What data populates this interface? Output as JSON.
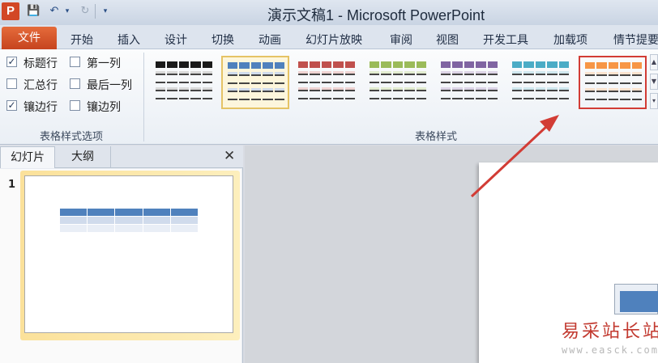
{
  "titlebar": {
    "app_icon": "P",
    "title": "演示文稿1 - Microsoft PowerPoint",
    "qat": {
      "save": "save-icon",
      "undo": "undo-icon",
      "redo": "redo-icon"
    }
  },
  "tabs": {
    "file": "文件",
    "items": [
      "开始",
      "插入",
      "设计",
      "切换",
      "动画",
      "幻灯片放映",
      "审阅",
      "视图",
      "开发工具",
      "加载项",
      "情节提要"
    ]
  },
  "ribbon": {
    "options_group": {
      "label": "表格样式选项",
      "options": [
        {
          "label": "标题行",
          "checked": true
        },
        {
          "label": "第一列",
          "checked": false
        },
        {
          "label": "汇总行",
          "checked": false
        },
        {
          "label": "最后一列",
          "checked": false
        },
        {
          "label": "镶边行",
          "checked": true
        },
        {
          "label": "镶边列",
          "checked": false
        }
      ]
    },
    "styles_group": {
      "label": "表格样式",
      "styles": [
        {
          "header": "#1a1a1a",
          "band": "#d9d9d9",
          "state": "normal"
        },
        {
          "header": "#4f81bd",
          "band": "#d0dbec",
          "state": "selected"
        },
        {
          "header": "#c0504d",
          "band": "#efd3d2",
          "state": "normal"
        },
        {
          "header": "#9bbb59",
          "band": "#e2ecd0",
          "state": "normal"
        },
        {
          "header": "#8064a2",
          "band": "#dcd4e6",
          "state": "normal"
        },
        {
          "header": "#4bacc6",
          "band": "#d0e8ef",
          "state": "normal"
        },
        {
          "header": "#f79646",
          "band": "#fbe3cf",
          "state": "outlined"
        }
      ]
    }
  },
  "left_pane": {
    "tab_slides": "幻灯片",
    "tab_outline": "大纲",
    "close": "✕",
    "slide_number": "1"
  },
  "watermark": {
    "text": "易采站长站",
    "url": "www.easck.com"
  },
  "colors": {
    "accent": "#4f81bd",
    "file_tab": "#d24726",
    "highlight_box": "#d23c35"
  }
}
